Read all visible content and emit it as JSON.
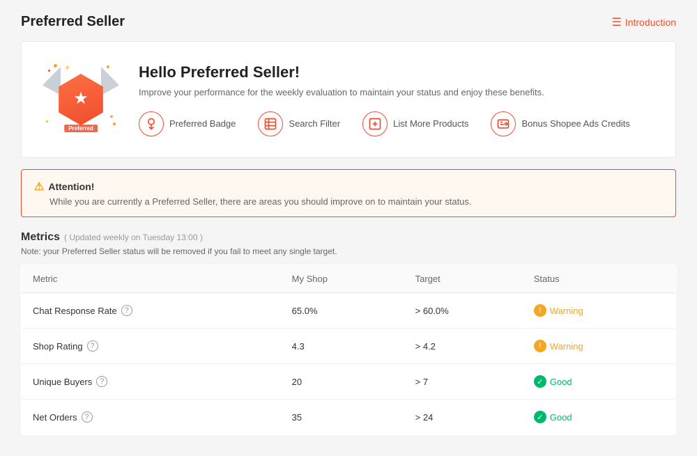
{
  "page": {
    "title": "Preferred Seller",
    "intro_link": "Introduction"
  },
  "hero": {
    "badge_label": "Preferred",
    "title": "Hello Preferred Seller!",
    "description": "Improve your performance for the weekly evaluation to maintain your status and enjoy these benefits.",
    "benefits": [
      {
        "id": "badge",
        "label": "Preferred Badge",
        "icon": "🏅"
      },
      {
        "id": "filter",
        "label": "Search Filter",
        "icon": "🔍"
      },
      {
        "id": "products",
        "label": "List More Products",
        "icon": "📋"
      },
      {
        "id": "ads",
        "label": "Bonus Shopee Ads Credits",
        "icon": "📢"
      }
    ]
  },
  "attention": {
    "title": "Attention!",
    "text": "While you are currently a Preferred Seller, there are areas you should improve on to maintain your status."
  },
  "metrics": {
    "title": "Metrics",
    "subtitle": "( Updated weekly on Tuesday 13:00 )",
    "note": "Note: your Preferred Seller status will be removed if you fail to meet any single target.",
    "columns": [
      "Metric",
      "My Shop",
      "Target",
      "Status"
    ],
    "rows": [
      {
        "metric": "Chat Response Rate",
        "my_shop": "65.0%",
        "target": "> 60.0%",
        "status": "Warning",
        "status_type": "warning"
      },
      {
        "metric": "Shop Rating",
        "my_shop": "4.3",
        "target": "> 4.2",
        "status": "Warning",
        "status_type": "warning"
      },
      {
        "metric": "Unique Buyers",
        "my_shop": "20",
        "target": "> 7",
        "status": "Good",
        "status_type": "good"
      },
      {
        "metric": "Net Orders",
        "my_shop": "35",
        "target": "> 24",
        "status": "Good",
        "status_type": "good"
      }
    ]
  }
}
